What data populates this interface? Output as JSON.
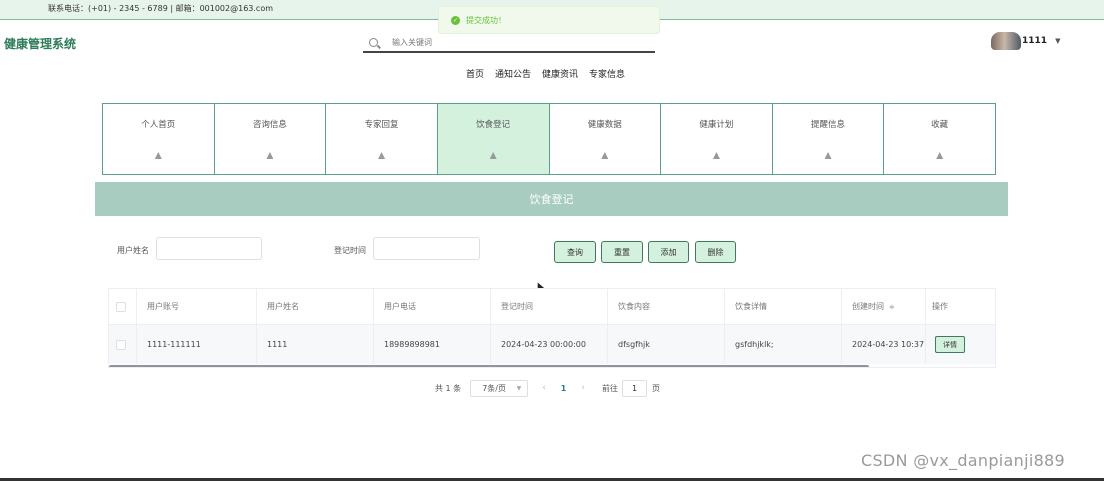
{
  "header": {
    "contact": "联系电话：(+01) - 2345 - 6789 | 邮箱：001002@163.com",
    "brand": "健康管理系统",
    "search": {
      "placeholder": "输入关键词"
    },
    "user": {
      "name": "1111"
    }
  },
  "toast": {
    "text": "提交成功！",
    "color": "#67c23a"
  },
  "top_nav": [
    "首页",
    "通知公告",
    "健康资讯",
    "专家信息"
  ],
  "tabs": [
    {
      "label": "个人首页",
      "icon": "home-icon"
    },
    {
      "label": "咨询信息",
      "icon": "home-icon"
    },
    {
      "label": "专家回复",
      "icon": "home-icon"
    },
    {
      "label": "饮食登记",
      "icon": "home-icon",
      "active": true
    },
    {
      "label": "健康数据",
      "icon": "home-icon"
    },
    {
      "label": "健康计划",
      "icon": "home-icon"
    },
    {
      "label": "提醒信息",
      "icon": "home-icon"
    },
    {
      "label": "收藏",
      "icon": "home-icon"
    }
  ],
  "section": {
    "title": "饮食登记"
  },
  "filters": {
    "name_label": "用户姓名",
    "name_value": "",
    "time_label": "登记时间",
    "time_value": ""
  },
  "buttons": {
    "query": "查询",
    "reset": "重置",
    "add": "添加",
    "delete": "删除"
  },
  "table": {
    "columns": [
      "用户账号",
      "用户姓名",
      "用户电话",
      "登记时间",
      "饮食内容",
      "饮食详情",
      "创建时间",
      "操作"
    ],
    "rows": [
      {
        "account": "1111-111111",
        "name": "1111",
        "phone": "18989898981",
        "reg_time": "2024-04-23 00:00:00",
        "content": "dfsgfhjk",
        "detail": "gsfdhjklk;",
        "created": "2024-04-23 10:37:32",
        "action": "详情"
      }
    ]
  },
  "pagination": {
    "total": "共 1 条",
    "page_size": "7条/页",
    "current": "1",
    "goto_label": "前往",
    "goto_value": "1",
    "goto_unit": "页"
  },
  "watermark": "CSDN @vx_danpianji889",
  "colors": {
    "accent": "#2e7d5b",
    "tab_active": "#d4f1de",
    "section_bar": "#a9ccc0",
    "button_bg": "#d4f1de"
  }
}
